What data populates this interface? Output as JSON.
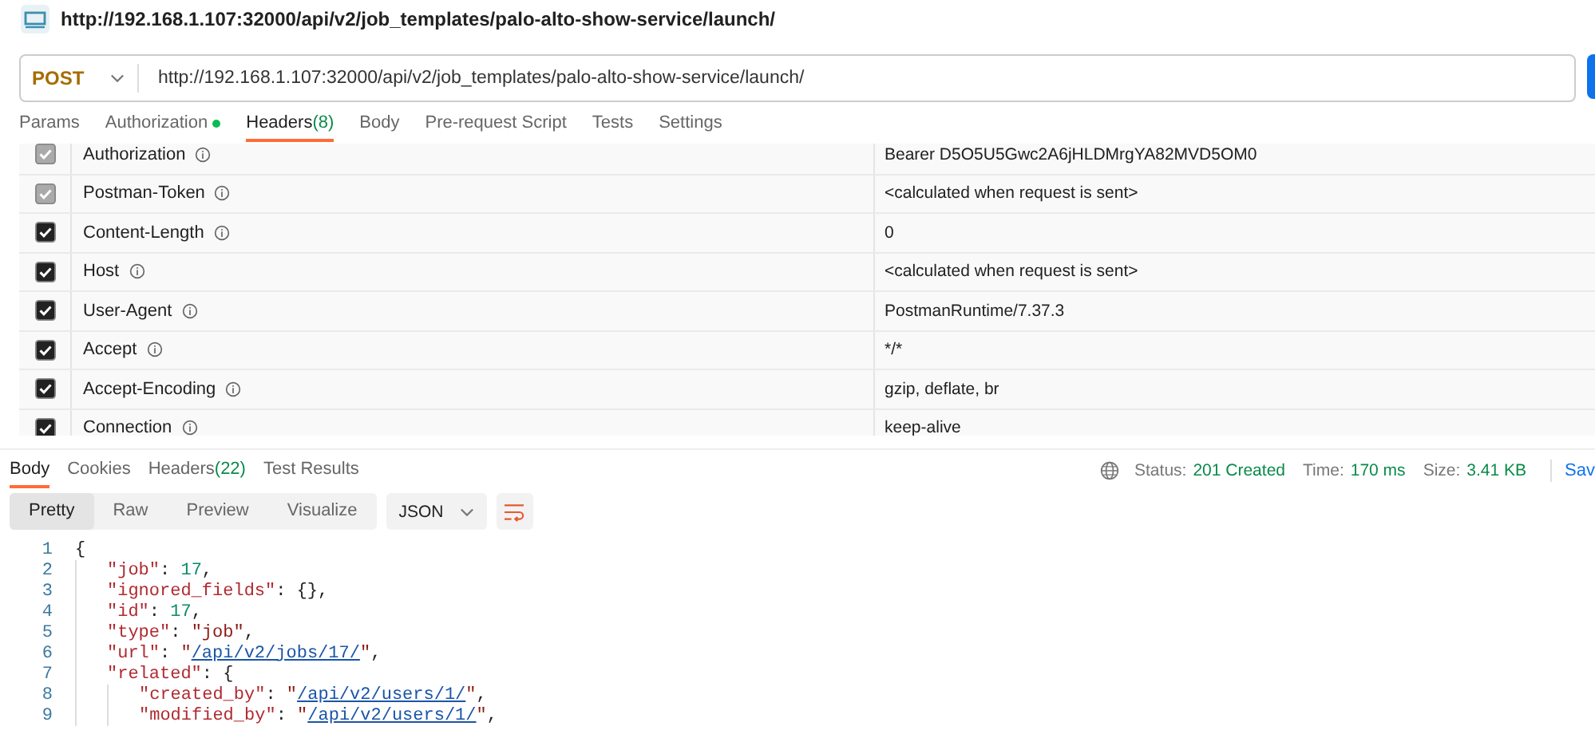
{
  "title_bar": {
    "url": "http://192.168.1.107:32000/api/v2/job_templates/palo-alto-show-service/launch/"
  },
  "request": {
    "method": "POST",
    "url": "http://192.168.1.107:32000/api/v2/job_templates/palo-alto-show-service/launch/"
  },
  "request_tabs": [
    {
      "label": "Params",
      "selected": false
    },
    {
      "label": "Authorization",
      "selected": false,
      "dot": true
    },
    {
      "label": "Headers",
      "count": "(8)",
      "selected": true
    },
    {
      "label": "Body",
      "selected": false
    },
    {
      "label": "Pre-request Script",
      "selected": false
    },
    {
      "label": "Tests",
      "selected": false
    },
    {
      "label": "Settings",
      "selected": false
    }
  ],
  "headers": [
    {
      "key": "Authorization",
      "value": "Bearer D5O5U5Gwc2A6jHLDMrgYA82MVD5OM0",
      "checked": true,
      "disabled": true
    },
    {
      "key": "Postman-Token",
      "value": "<calculated when request is sent>",
      "checked": true,
      "disabled": true
    },
    {
      "key": "Content-Length",
      "value": "0",
      "checked": true,
      "disabled": false
    },
    {
      "key": "Host",
      "value": "<calculated when request is sent>",
      "checked": true,
      "disabled": false
    },
    {
      "key": "User-Agent",
      "value": "PostmanRuntime/7.37.3",
      "checked": true,
      "disabled": false
    },
    {
      "key": "Accept",
      "value": "*/*",
      "checked": true,
      "disabled": false
    },
    {
      "key": "Accept-Encoding",
      "value": "gzip, deflate, br",
      "checked": true,
      "disabled": false
    },
    {
      "key": "Connection",
      "value": "keep-alive",
      "checked": true,
      "disabled": false
    }
  ],
  "response_tabs": [
    {
      "label": "Body",
      "selected": true
    },
    {
      "label": "Cookies",
      "selected": false
    },
    {
      "label": "Headers",
      "count": "(22)",
      "selected": false
    },
    {
      "label": "Test Results",
      "selected": false
    }
  ],
  "status": {
    "status_label": "Status:",
    "status": "201 Created",
    "time_label": "Time:",
    "time": "170 ms",
    "size_label": "Size:",
    "size": "3.41 KB",
    "save": "Sav"
  },
  "view_modes": [
    {
      "label": "Pretty",
      "selected": true
    },
    {
      "label": "Raw",
      "selected": false
    },
    {
      "label": "Preview",
      "selected": false
    },
    {
      "label": "Visualize",
      "selected": false
    }
  ],
  "format": "JSON",
  "code": [
    {
      "number": "1",
      "tokens": [
        {
          "kind": "punct",
          "text": "{"
        }
      ],
      "children": [
        {
          "number": "2",
          "tokens": [
            {
              "kind": "key",
              "text": "\"job\""
            },
            {
              "kind": "punct",
              "text": ": "
            },
            {
              "kind": "number",
              "text": "17"
            },
            {
              "kind": "punct",
              "text": ","
            }
          ]
        },
        {
          "number": "3",
          "tokens": [
            {
              "kind": "key",
              "text": "\"ignored_fields\""
            },
            {
              "kind": "punct",
              "text": ": {},"
            }
          ]
        },
        {
          "number": "4",
          "tokens": [
            {
              "kind": "key",
              "text": "\"id\""
            },
            {
              "kind": "punct",
              "text": ": "
            },
            {
              "kind": "number",
              "text": "17"
            },
            {
              "kind": "punct",
              "text": ","
            }
          ]
        },
        {
          "number": "5",
          "tokens": [
            {
              "kind": "key",
              "text": "\"type\""
            },
            {
              "kind": "punct",
              "text": ": "
            },
            {
              "kind": "string",
              "text": "\"job\""
            },
            {
              "kind": "punct",
              "text": ","
            }
          ]
        },
        {
          "number": "6",
          "tokens": [
            {
              "kind": "key",
              "text": "\"url\""
            },
            {
              "kind": "punct",
              "text": ": "
            },
            {
              "kind": "string",
              "text": "\""
            },
            {
              "kind": "link",
              "text": "/api/v2/jobs/17/"
            },
            {
              "kind": "string",
              "text": "\""
            },
            {
              "kind": "punct",
              "text": ","
            }
          ]
        },
        {
          "number": "7",
          "tokens": [
            {
              "kind": "key",
              "text": "\"related\""
            },
            {
              "kind": "punct",
              "text": ": {"
            }
          ],
          "children": [
            {
              "number": "8",
              "tokens": [
                {
                  "kind": "key",
                  "text": "\"created_by\""
                },
                {
                  "kind": "punct",
                  "text": ": "
                },
                {
                  "kind": "string",
                  "text": "\""
                },
                {
                  "kind": "link",
                  "text": "/api/v2/users/1/"
                },
                {
                  "kind": "string",
                  "text": "\""
                },
                {
                  "kind": "punct",
                  "text": ","
                }
              ]
            },
            {
              "number": "9",
              "tokens": [
                {
                  "kind": "key",
                  "text": "\"modified_by\""
                },
                {
                  "kind": "punct",
                  "text": ": "
                },
                {
                  "kind": "string",
                  "text": "\""
                },
                {
                  "kind": "link",
                  "text": "/api/v2/users/1/"
                },
                {
                  "kind": "string",
                  "text": "\""
                },
                {
                  "kind": "punct",
                  "text": ","
                }
              ]
            }
          ]
        }
      ]
    }
  ]
}
